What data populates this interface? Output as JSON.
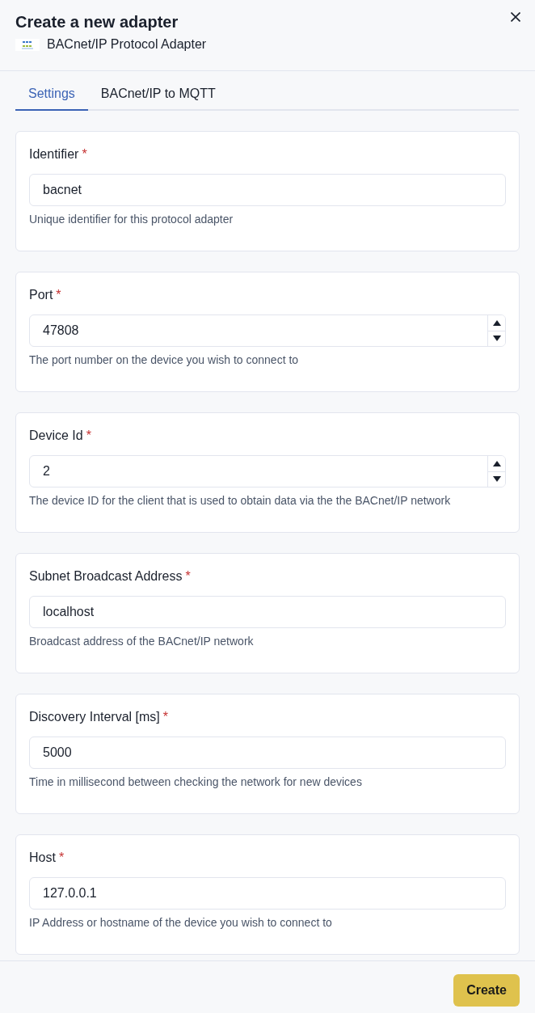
{
  "dialog": {
    "title": "Create a new adapter",
    "subtitle": "BACnet/IP Protocol Adapter"
  },
  "tabs": [
    {
      "label": "Settings",
      "selected": true
    },
    {
      "label": "BACnet/IP to MQTT",
      "selected": false
    }
  ],
  "fields": [
    {
      "kind": "text",
      "label": "Identifier",
      "required_mark": "*",
      "value": "bacnet",
      "help": "Unique identifier for this protocol adapter"
    },
    {
      "kind": "number",
      "label": "Port",
      "required_mark": "*",
      "value": "47808",
      "help": "The port number on the device you wish to connect to"
    },
    {
      "kind": "number",
      "label": "Device Id",
      "required_mark": "*",
      "value": "2",
      "help": "The device ID for the client that is used to obtain data via the the BACnet/IP network"
    },
    {
      "kind": "text",
      "label": "Subnet Broadcast Address",
      "required_mark": "*",
      "value": "localhost",
      "help": "Broadcast address of the BACnet/IP network"
    },
    {
      "kind": "text",
      "label": "Discovery Interval [ms]",
      "required_mark": "*",
      "value": "5000",
      "help": "Time in millisecond between checking the network for new devices"
    },
    {
      "kind": "text",
      "label": "Host",
      "required_mark": "*",
      "value": "127.0.0.1",
      "help": "IP Address or hostname of the device you wish to connect to"
    }
  ],
  "footer": {
    "buttons": [
      "Create"
    ]
  }
}
